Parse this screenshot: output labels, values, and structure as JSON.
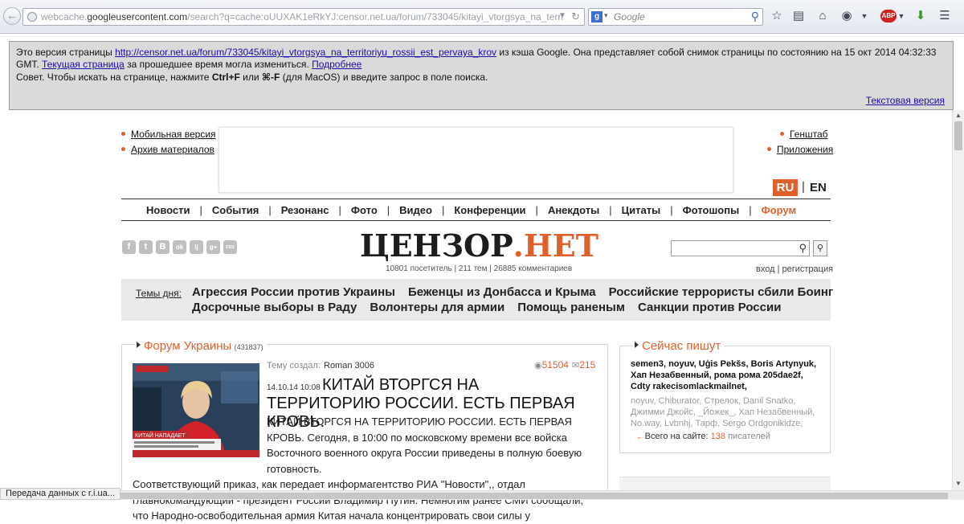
{
  "browser": {
    "url_prefix": "webcache.",
    "url_host": "googleusercontent.com",
    "url_rest": "/search?q=cache:oUUXAK1eRkYJ:censor.net.ua/forum/733045/kitayi_vtorgsya_na_territoriyu_rossii_est_",
    "search_engine_letter": "g",
    "search_placeholder": "Google",
    "abp_label": "ABP"
  },
  "cache_banner": {
    "prefix": "Это версия страницы ",
    "link_url": "http://censor.net.ua/forum/733045/kitayi_vtorgsya_na_territoriyu_rossii_est_pervaya_krov",
    "middle": " из кэша Google. Она представляет собой снимок страницы по состоянию на 15 окт 2014 04:32:33 GMT. ",
    "current_link": "Текущая страница",
    "suffix": " за прошедшее время могла измениться. ",
    "more_link": "Подробнее",
    "tip_prefix": "Совет. Чтобы искать на странице, нажмите ",
    "tip_key1": "Ctrl+F",
    "tip_or": " или ",
    "tip_key2": "⌘-F",
    "tip_suffix": " (для MacOS) и введите запрос в поле поиска.",
    "text_version_link": "Текстовая версия"
  },
  "header": {
    "left_links": [
      "Мобильная версия",
      "Архив материалов"
    ],
    "right_links": [
      "Генштаб",
      "Приложения"
    ],
    "lang_ru": "RU",
    "lang_sep": "|",
    "lang_en": "EN"
  },
  "nav": {
    "items": [
      "Новости",
      "События",
      "Резонанс",
      "Фото",
      "Видео",
      "Конференции",
      "Анекдоты",
      "Цитаты",
      "Фотошопы",
      "Форум"
    ],
    "separator": "|",
    "active_index": 9
  },
  "social_icons": [
    "f",
    "t",
    "B",
    "ok",
    "lj",
    "g+",
    "rss"
  ],
  "logo": {
    "left": "ЦЕНЗОР",
    "dot": ".",
    "right": "НЕТ",
    "stats": "10801 посетитель | 211 тем | 26885 комментариев"
  },
  "auth": {
    "login": "вход",
    "sep": " | ",
    "register": "регистрация"
  },
  "topics": {
    "label": "Темы дня:",
    "row1": [
      "Агрессия России против Украины",
      "Беженцы из Донбасса и Крыма",
      "Российские террористы сбили Боинг"
    ],
    "row2": [
      "Досрочные выборы в Раду",
      "Волонтеры для армии",
      "Помощь раненым",
      "Санкции против России"
    ]
  },
  "forum": {
    "title": "Форум Украины",
    "count": "(431837)",
    "author_label": "Тему создал:",
    "author": "Roman 3006",
    "views": "51504",
    "comments": "215",
    "date": "14.10.14 10:08",
    "post_title": "КИТАЙ ВТОРГСЯ НА ТЕРРИТОРИЮ РОССИИ. ЕСТЬ ПЕРВАЯ КРОВЬ.",
    "body_lead": "КИТАЙ ВТОРГСЯ НА ТЕРРИТОРИЮ РОССИИ. ЕСТЬ ПЕРВАЯ КРОВЬ. Сегодня, в 10:00 по московскому времени все войска Восточного военного округа России приведены в полную боевую готовность.",
    "body_rest": "Соответствующий приказ, как передает информагентство РИА \"Новости\",, отдал главнокомандующий - президент России Владимир Путин. Немногим ранее СМИ сообщали, что Народно-освободительная армия Китая начала концентрировать свои силы у",
    "thumb_caption": "КИТАЙ НАПАДАЕТ"
  },
  "now_writing": {
    "title": "Сейчас пишут",
    "users": "semen3, noyuv, Uģis Pekšs, Boris Artynyuk, Хап Незабвенный, рома рома 205dae2f, Cdty rakecisomlackmailnet,",
    "guests": "noyuv, Chiburator, Стрелок, Danil Snatko, Джимми Джойс, _Йожек_, Хап Незабвенный, No.way, Lvbnhj, Тарф, Sergo Ordgonikidze,",
    "total_label": "Всего на сайте:",
    "total_num": "138",
    "total_suffix": "писателей"
  },
  "status_bar": "Передача данных с r.i.ua...",
  "colors": {
    "accent": "#e0602a",
    "banner_bg": "#dadada",
    "topics_bg": "#e9e9e9"
  }
}
